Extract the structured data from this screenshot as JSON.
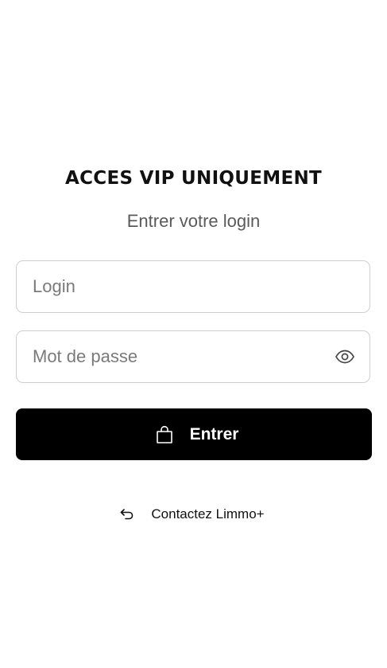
{
  "header": {
    "title": "ACCES VIP UNIQUEMENT",
    "subtitle": "Entrer votre login"
  },
  "form": {
    "login": {
      "value": "",
      "placeholder": "Login"
    },
    "password": {
      "value": "",
      "placeholder": "Mot de passe",
      "toggle_icon": "eye-icon"
    },
    "submit": {
      "label": "Entrer",
      "icon": "shopping-bag-icon"
    }
  },
  "footer": {
    "contact_label": "Contactez Limmo+",
    "contact_icon": "undo-arrow-icon"
  },
  "colors": {
    "background": "#ffffff",
    "button_bg": "#000000",
    "button_text": "#ffffff",
    "border": "#cfcfcf",
    "subtitle": "#5a5a5a"
  }
}
